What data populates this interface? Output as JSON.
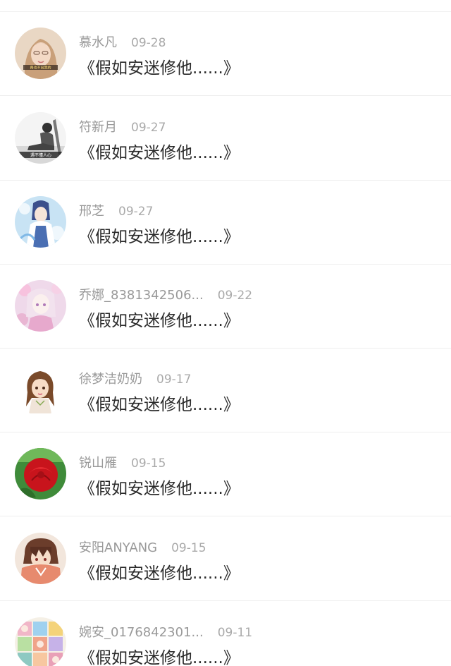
{
  "comments": [
    {
      "user": "慕水凡",
      "date": "09-28",
      "text": "《假如安迷修他......》",
      "avatar": "portrait-girl-glasses",
      "avatar_caption": "再也不出我的"
    },
    {
      "user": "符新月",
      "date": "09-27",
      "text": "《假如安迷修他......》",
      "avatar": "bw-sitting-boy",
      "avatar_caption": "遇不懂人心"
    },
    {
      "user": "邢芝",
      "date": "09-27",
      "text": "《假如安迷修他......》",
      "avatar": "anime-blue-character"
    },
    {
      "user": "乔娜_8381342506...",
      "date": "09-22",
      "text": "《假如安迷修他......》",
      "avatar": "anime-pink-girl"
    },
    {
      "user": "徐梦洁奶奶",
      "date": "09-17",
      "text": "《假如安迷修他......》",
      "avatar": "cartoon-brown-hair-girl"
    },
    {
      "user": "锐山雁",
      "date": "09-15",
      "text": "《假如安迷修他......》",
      "avatar": "red-rose"
    },
    {
      "user": "安阳ANYANG",
      "date": "09-15",
      "text": "《假如安迷修他......》",
      "avatar": "anime-boy-hood"
    },
    {
      "user": "婉安_0176842301...",
      "date": "09-11",
      "text": "《假如安迷修他......》",
      "avatar": "anime-collage"
    }
  ]
}
